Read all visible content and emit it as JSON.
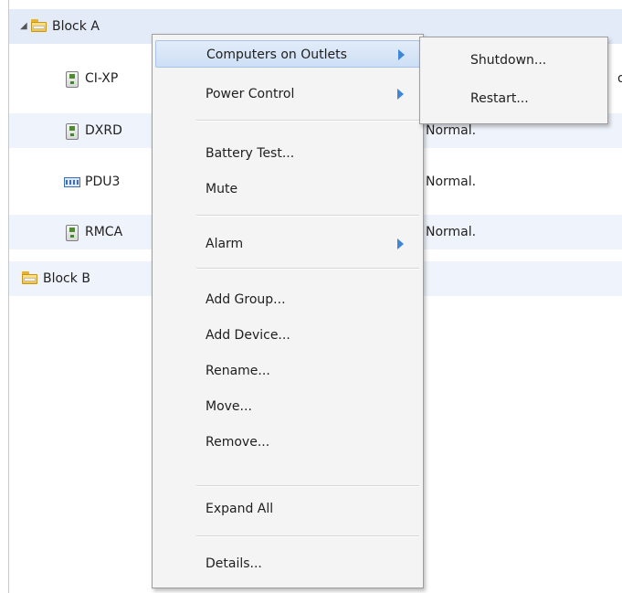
{
  "tree": {
    "rows": [
      {
        "label": "Block A",
        "status": ""
      },
      {
        "label": "CI-XP",
        "status": "or"
      },
      {
        "label": "DXRD",
        "status": "Normal."
      },
      {
        "label": "PDU3",
        "status": "Normal."
      },
      {
        "label": "RMCA",
        "status": "Normal."
      },
      {
        "label": "Block B",
        "status": ""
      }
    ]
  },
  "context_menu": {
    "items": {
      "computers_on_outlets": "Computers on Outlets",
      "power_control": "Power Control",
      "battery_test": "Battery Test...",
      "mute": "Mute",
      "alarm": "Alarm",
      "add_group": "Add Group...",
      "add_device": "Add Device...",
      "rename": "Rename...",
      "move": "Move...",
      "remove": "Remove...",
      "expand_all": "Expand All",
      "details": "Details..."
    }
  },
  "submenu": {
    "shutdown": "Shutdown...",
    "restart": "Restart..."
  }
}
